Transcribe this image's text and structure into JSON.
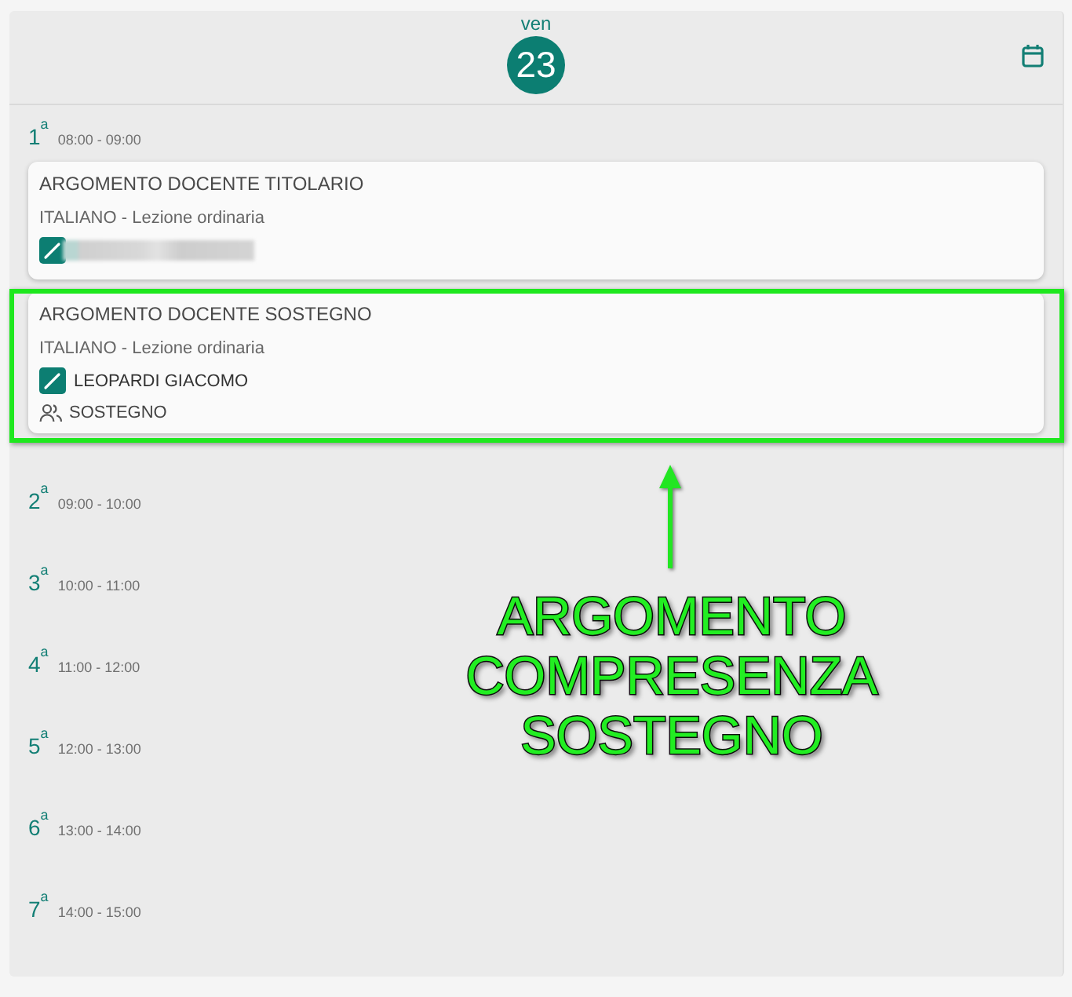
{
  "header": {
    "weekday": "ven",
    "day": "23"
  },
  "periods": [
    {
      "number": "1$^{a}$",
      "time": "08:00 - 09:00",
      "cards": [
        {
          "title": "ARGOMENTO DOCENTE TITOLARIO",
          "subject": "ITALIANO - Lezione ordinaria",
          "teacher": {
            "redacted": true
          },
          "highlighted": false
        },
        {
          "title": "ARGOMENTO DOCENTE SOSTEGNO",
          "subject": "ITALIANO - Lezione ordinaria",
          "teacher": {
            "redacted": false,
            "name": "LEOPARDI GIACOMO"
          },
          "group": "SOSTEGNO",
          "highlighted": true
        }
      ]
    },
    {
      "number": "2$^{a}$",
      "time": "09:00 - 10:00"
    },
    {
      "number": "3$^{a}$",
      "time": "10:00 - 11:00"
    },
    {
      "number": "4$^{a}$",
      "time": "11:00 - 12:00"
    },
    {
      "number": "5$^{a}$",
      "time": "12:00 - 13:00"
    },
    {
      "number": "6$^{a}$",
      "time": "13:00 - 14:00"
    },
    {
      "number": "7$^{a}$",
      "time": "14:00 - 15:00"
    }
  ],
  "annotation": {
    "lines": [
      "ARGOMENTO",
      "COMPRESENZA",
      "SOSTEGNO"
    ]
  }
}
